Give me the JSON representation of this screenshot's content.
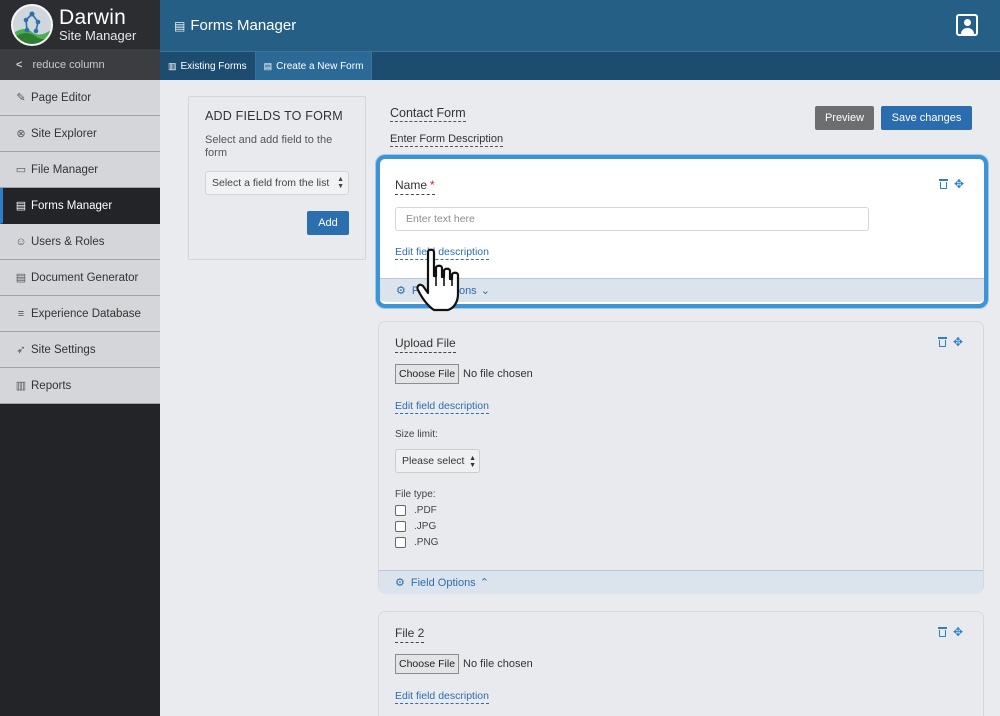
{
  "brand": {
    "title": "Darwin",
    "subtitle": "Site Manager"
  },
  "sidebar": {
    "reduce_label": "reduce column",
    "items": [
      {
        "label": "Page Editor",
        "icon": "edit-icon",
        "glyph": "✎",
        "active": false
      },
      {
        "label": "Site Explorer",
        "icon": "binoculars-icon",
        "glyph": "⊗",
        "active": false
      },
      {
        "label": "File Manager",
        "icon": "folder-icon",
        "glyph": "▭",
        "active": false
      },
      {
        "label": "Forms Manager",
        "icon": "document-icon",
        "glyph": "▤",
        "active": true
      },
      {
        "label": "Users & Roles",
        "icon": "user-icon",
        "glyph": "☺",
        "active": false
      },
      {
        "label": "Document Generator",
        "icon": "document-icon",
        "glyph": "▤",
        "active": false
      },
      {
        "label": "Experience Database",
        "icon": "database-icon",
        "glyph": "≡",
        "active": false
      },
      {
        "label": "Site Settings",
        "icon": "rocket-icon",
        "glyph": "➶",
        "active": false
      },
      {
        "label": "Reports",
        "icon": "chart-icon",
        "glyph": "▥",
        "active": false
      }
    ]
  },
  "header": {
    "title": "Forms Manager"
  },
  "tabs": [
    {
      "label": "Existing Forms",
      "icon": "chart-icon",
      "glyph": "▥",
      "active": false
    },
    {
      "label": "Create a New Form",
      "icon": "clipboard-icon",
      "glyph": "▤",
      "active": true
    }
  ],
  "add_panel": {
    "title": "ADD FIELDS TO FORM",
    "description": "Select and add field to the form",
    "select_value": "Select a field from the list",
    "add_label": "Add"
  },
  "form": {
    "title": "Contact Form",
    "description": "Enter Form Description",
    "preview_label": "Preview",
    "save_label": "Save changes"
  },
  "fields": {
    "name": {
      "label": "Name",
      "required_mark": "*",
      "placeholder": "Enter text here",
      "edit_desc": "Edit field description",
      "options_label": "Field Options",
      "options_chevron": "⌄"
    },
    "upload": {
      "label": "Upload File",
      "choose_label": "Choose File",
      "no_file": "No file chosen",
      "edit_desc": "Edit field description",
      "size_label": "Size limit:",
      "size_value": "Please select",
      "type_label": "File type:",
      "types": [
        ".PDF",
        ".JPG",
        ".PNG"
      ],
      "options_label": "Field Options",
      "options_chevron": "⌃"
    },
    "file2": {
      "label": "File 2",
      "choose_label": "Choose File",
      "no_file": "No file chosen",
      "edit_desc": "Edit field description"
    }
  },
  "colors": {
    "accent": "#2c7fc7",
    "header": "#265f86",
    "sidebar": "#232427",
    "required": "#d9232d"
  }
}
